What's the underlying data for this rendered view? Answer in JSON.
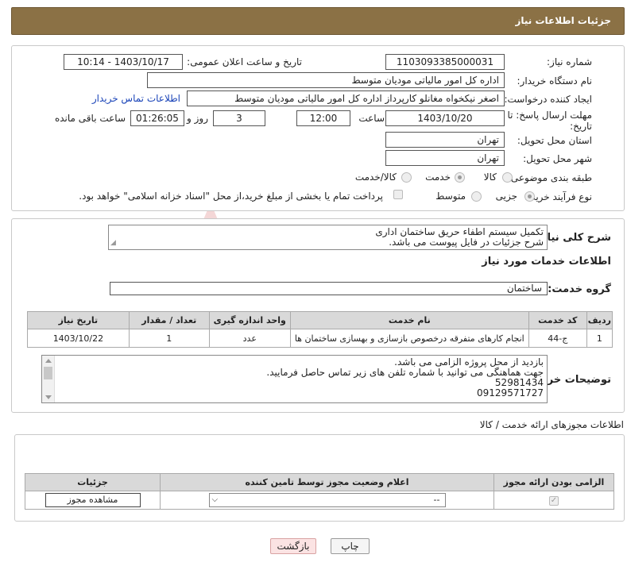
{
  "header": {
    "title": "جزئیات اطلاعات نیاز"
  },
  "form": {
    "need_number_label": "شماره نیاز:",
    "need_number": "1103093385000031",
    "announce_label": "تاریخ و ساعت اعلان عمومی:",
    "announce_value": "1403/10/17 - 10:14",
    "buyer_org_label": "نام دستگاه خریدار:",
    "buyer_org": "اداره کل امور مالیاتی مودیان متوسط",
    "requester_label": "ایجاد کننده درخواست:",
    "requester": "اصغر نیکخواه مغانلو کارپرداز اداره کل امور مالیاتی مودیان متوسط",
    "contact_link": "اطلاعات تماس خریدار",
    "deadline_label_1": "مهلت ارسال پاسخ: تا",
    "deadline_label_2": "تاریخ:",
    "deadline_date": "1403/10/20",
    "time_label": "ساعت",
    "deadline_time": "12:00",
    "days_value": "3",
    "days_label": "روز و",
    "remaining_time": "01:26:05",
    "remaining_label": "ساعت باقی مانده",
    "province_label": "استان محل تحویل:",
    "province": "تهران",
    "city_label": "شهر محل تحویل:",
    "city": "تهران",
    "category_label": "طبقه بندی موضوعی:",
    "category_options": [
      "کالا",
      "خدمت",
      "کالا/خدمت"
    ],
    "category_selected": "خدمت",
    "process_label": "نوع فرآیند خرید :",
    "process_options": [
      "جزیی",
      "متوسط"
    ],
    "process_selected": "جزیی",
    "treasury_text": "پرداخت تمام یا بخشی از مبلغ خرید،از محل \"اسناد خزانه اسلامی\" خواهد بود."
  },
  "summary": {
    "label": "شرح کلی نیاز:",
    "line1": "تکمیل سیستم اطفاء حریق ساختمان اداری",
    "line2": "شرح جزئیات در فایل پیوست می باشد."
  },
  "services": {
    "section_title": "اطلاعات خدمات مورد نیاز",
    "group_label": "گروه خدمت:",
    "group_value": "ساختمان",
    "columns": [
      "ردیف",
      "کد خدمت",
      "نام خدمت",
      "واحد اندازه گیری",
      "تعداد / مقدار",
      "تاریخ نیاز"
    ],
    "rows": [
      [
        "1",
        "ج-44",
        "انجام کارهای متفرقه درخصوص بازسازی و بهسازی ساختمان ها",
        "عدد",
        "1",
        "1403/10/22"
      ]
    ]
  },
  "buyer_notes": {
    "label": "توضیحات خریدار:",
    "lines": [
      "بازدید از محل پروژه الزامی می باشد.",
      "جهت هماهنگی می توانید با شماره تلفن های زیر تماس حاصل فرمایید.",
      "52981434",
      "09129571727"
    ]
  },
  "permits": {
    "title": "اطلاعات مجوزهای ارائه خدمت / کالا",
    "columns": [
      "الزامی بودن ارائه مجوز",
      "اعلام وضعیت مجوز توسط تامین کننده",
      "جزئیات"
    ],
    "select_value": "--",
    "view_button": "مشاهده مجوز"
  },
  "footer": {
    "print_button": "چاپ",
    "back_button": "بازگشت"
  },
  "watermark": {
    "text": "AriaTender.neT"
  }
}
